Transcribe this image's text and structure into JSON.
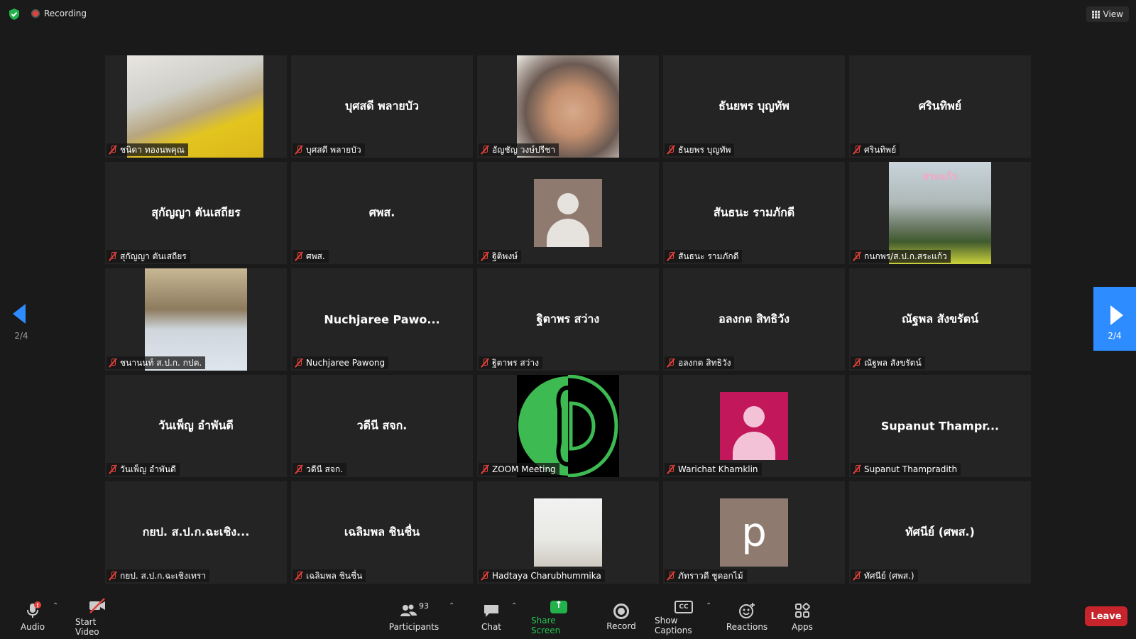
{
  "topbar": {
    "recording_label": "Recording",
    "view_label": "View"
  },
  "tiles": [
    {
      "display_name": "",
      "label": "ชนิดา ทองนพคุณ"
    },
    {
      "display_name": "บุศสดี พลายบัว",
      "label": "บุศสดี พลายบัว"
    },
    {
      "display_name": "",
      "label": "อัญชัญ วงษ์ปรีชา"
    },
    {
      "display_name": "ธันยพร บุญทัพ",
      "label": "ธันยพร บุญทัพ"
    },
    {
      "display_name": "ศรินทิพย์",
      "label": "ศรินทิพย์"
    },
    {
      "display_name": "สุกัญญา ตันเสถียร",
      "label": "สุกัญญา ตันเสถียร"
    },
    {
      "display_name": "ศพส.",
      "label": "ศพส."
    },
    {
      "display_name": "",
      "label": "ฐิติพงษ์"
    },
    {
      "display_name": "สันธนะ รามภักดี",
      "label": "สันธนะ รามภักดี"
    },
    {
      "display_name": "",
      "label": "กนกพร/ส.ป.ก.สระแก้ว",
      "overlay_text": "สระแก้ว"
    },
    {
      "display_name": "",
      "label": "ชนานนท์ ส.ป.ก. กปต."
    },
    {
      "display_name": "Nuchjaree Pawo...",
      "label": "Nuchjaree Pawong"
    },
    {
      "display_name": "ฐิตาพร สว่าง",
      "label": "ฐิตาพร สว่าง"
    },
    {
      "display_name": "อลงกต สิทธิวัง",
      "label": "อลงกต สิทธิวัง"
    },
    {
      "display_name": "ณัฐพล สังขรัตน์",
      "label": "ณัฐพล สังขรัตน์"
    },
    {
      "display_name": "วันเพ็ญ อำพันดี",
      "label": "วันเพ็ญ อำพันดี"
    },
    {
      "display_name": "วดีนี สจก.",
      "label": "วดีนี สจก."
    },
    {
      "display_name": "",
      "label": "ZOOM Meeting"
    },
    {
      "display_name": "",
      "label": "Warichat Khamklin"
    },
    {
      "display_name": "Supanut Thampr...",
      "label": "Supanut Thampradith"
    },
    {
      "display_name": "กยป. ส.ป.ก.ฉะเชิง...",
      "label": "กยป. ส.ป.ก.ฉะเชิงเทรา"
    },
    {
      "display_name": "เฉลิมพล ชินชื่น",
      "label": "เฉลิมพล ชินชื่น"
    },
    {
      "display_name": "",
      "label": "Hadtaya Charubhummika"
    },
    {
      "display_name": "",
      "label": "ภัทราวดี ชูดอกไม้",
      "avatar_letter": "p"
    },
    {
      "display_name": "ทัศนีย์ (ศพส.)",
      "label": "ทัศนีย์ (ศพส.)"
    }
  ],
  "pagination": {
    "left": "2/4",
    "right": "2/4"
  },
  "toolbar": {
    "audio": "Audio",
    "start_video": "Start Video",
    "participants": "Participants",
    "participants_count": "93",
    "chat": "Chat",
    "share_screen": "Share Screen",
    "record": "Record",
    "show_captions": "Show Captions",
    "captions_icon_text": "CC",
    "reactions": "Reactions",
    "apps": "Apps",
    "leave": "Leave",
    "audio_alert": "!"
  },
  "colors": {
    "accent_blue": "#2d8cff",
    "leave_red": "#c8242b",
    "share_green": "#23b14d",
    "mute_red": "#e0413a"
  }
}
